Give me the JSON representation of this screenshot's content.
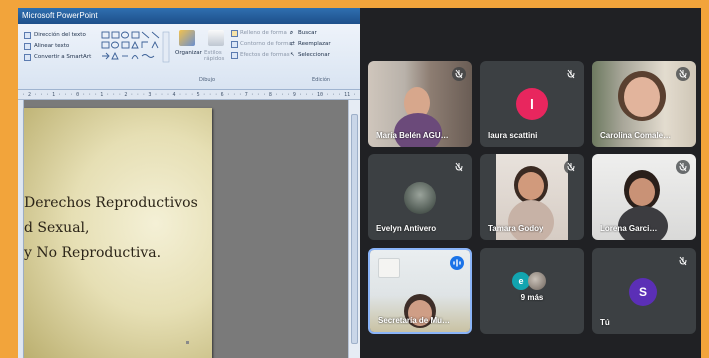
{
  "ppt": {
    "title": "Microsoft PowerPoint",
    "ribbon": {
      "text_direction": "Dirección del texto",
      "align_text": "Alinear texto",
      "smartart": "Convertir a SmartArt",
      "arrange": "Organizar",
      "quick_styles": "Estilos rápidos",
      "shape_fill": "Relleno de forma",
      "shape_outline": "Contorno de forma",
      "shape_effects": "Efectos de formas",
      "find": "Buscar",
      "replace": "Reemplazar",
      "select": "Seleccionar",
      "group_drawing": "Dibujo",
      "group_editing": "Edición"
    },
    "ruler": "· 2 · · · 1 · · · 0 · · · 1 · · · 2 · · · 3 · · · 4 · · · 5 · · · 6 · · · 7 · · · 8 · · · 9 · · · 10 · · · 11 · · · 12 ·",
    "slide_lines": [
      "Derechos Reproductivos",
      "d Sexual,",
      "y No Reproductiva."
    ]
  },
  "meet": {
    "colors": {
      "background": "#202124",
      "tile": "#3c4043",
      "active_border": "#8ab4f8"
    },
    "participants": [
      {
        "name": "María Belén AGU…",
        "muted": true
      },
      {
        "name": "laura scattini",
        "initial": "l",
        "avatar_color": "#e8265e",
        "muted": true
      },
      {
        "name": "Carolina Comale…",
        "muted": true
      },
      {
        "name": "Evelyn Antivero",
        "muted": true
      },
      {
        "name": "Tamara Godoy",
        "muted": true
      },
      {
        "name": "Lorena Garci…",
        "muted": true
      },
      {
        "name": "Secretaría de Mu…",
        "speaking": true
      },
      {
        "name": "9 más",
        "chip_initial": "e",
        "chip_color": "#12a4af"
      },
      {
        "name": "Tú",
        "initial": "S",
        "avatar_color": "#5b2fb6",
        "muted": true
      }
    ]
  }
}
